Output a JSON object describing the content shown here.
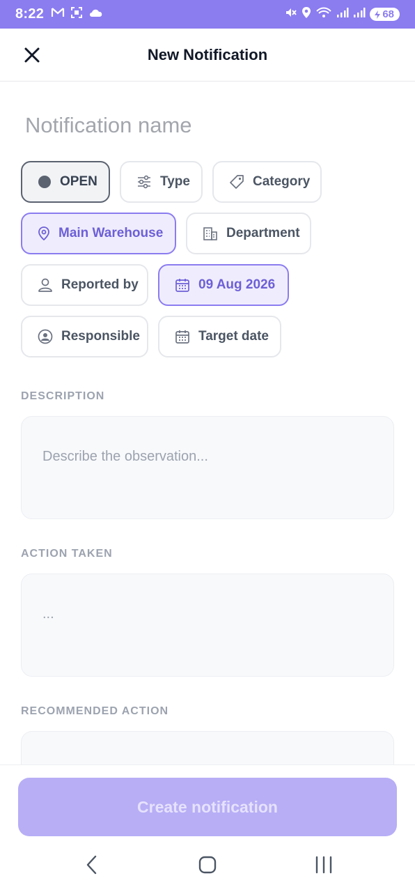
{
  "status_bar": {
    "time": "8:22",
    "battery": "68",
    "left_icons": [
      "gmail-icon",
      "screenshot-icon",
      "cloud-icon"
    ],
    "right_icons": [
      "mute-icon",
      "location-icon",
      "wifi-icon",
      "signal-icon",
      "signal-icon",
      "battery-icon"
    ]
  },
  "header": {
    "title": "New Notification"
  },
  "form": {
    "name_placeholder": "Notification name",
    "name_value": ""
  },
  "chips": {
    "status": "OPEN",
    "type": "Type",
    "category": "Category",
    "location": "Main Warehouse",
    "department": "Department",
    "reported_by": "Reported by",
    "date": "09 Aug 2026",
    "responsible": "Responsible",
    "target_date": "Target date"
  },
  "sections": {
    "description_label": "DESCRIPTION",
    "description_placeholder": "Describe the observation...",
    "action_taken_label": "ACTION TAKEN",
    "action_taken_placeholder": "...",
    "recommended_action_label": "RECOMMENDED ACTION"
  },
  "footer": {
    "create_label": "Create notification"
  },
  "colors": {
    "accent": "#8b7cf0",
    "accent_light": "#efedfd",
    "button_disabled": "#b7aef6",
    "muted_text": "#9ca3af"
  }
}
